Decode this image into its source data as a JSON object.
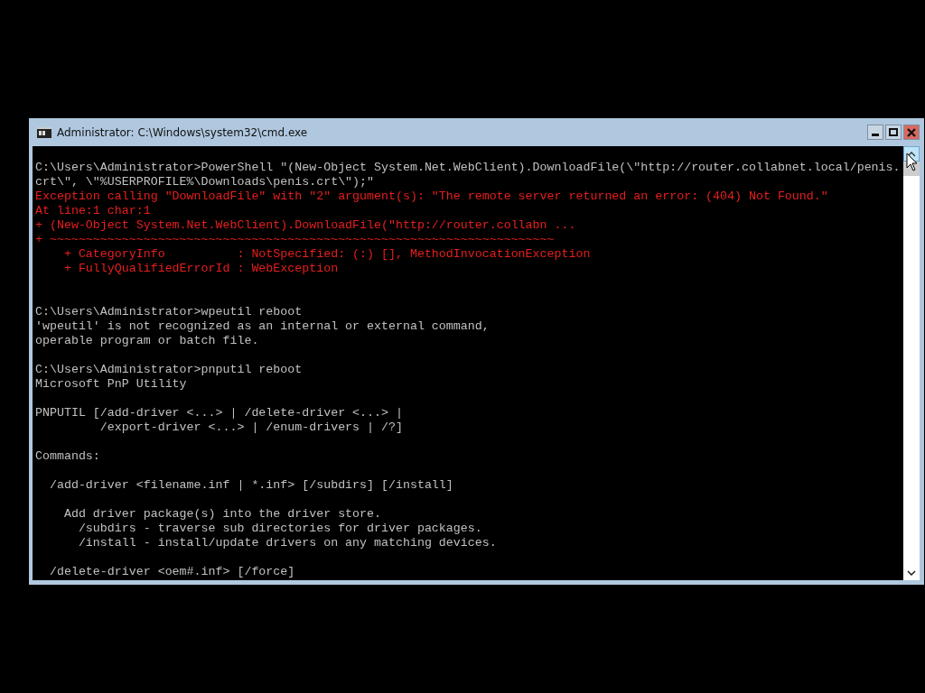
{
  "window": {
    "title": "Administrator: C:\\Windows\\system32\\cmd.exe"
  },
  "console": {
    "lines": [
      {
        "kind": "blank"
      },
      {
        "kind": "output",
        "text": "C:\\Users\\Administrator>PowerShell \"(New-Object System.Net.WebClient).DownloadFile(\\\"http://router.collabnet.local/penis."
      },
      {
        "kind": "output",
        "text": "crt\\\", \\\"%USERPROFILE%\\Downloads\\penis.crt\\\");\""
      },
      {
        "kind": "error",
        "text": "Exception calling \"DownloadFile\" with \"2\" argument(s): \"The remote server returned an error: (404) Not Found.\""
      },
      {
        "kind": "error",
        "text": "At line:1 char:1"
      },
      {
        "kind": "error",
        "text": "+ (New-Object System.Net.WebClient).DownloadFile(\"http://router.collabn ..."
      },
      {
        "kind": "error",
        "text": "+ ~~~~~~~~~~~~~~~~~~~~~~~~~~~~~~~~~~~~~~~~~~~~~~~~~~~~~~~~~~~~~~~~~~~~~~"
      },
      {
        "kind": "error",
        "text": "    + CategoryInfo          : NotSpecified: (:) [], MethodInvocationException"
      },
      {
        "kind": "error",
        "text": "    + FullyQualifiedErrorId : WebException"
      },
      {
        "kind": "blank"
      },
      {
        "kind": "blank"
      },
      {
        "kind": "output",
        "text": "C:\\Users\\Administrator>wpeutil reboot"
      },
      {
        "kind": "output",
        "text": "'wpeutil' is not recognized as an internal or external command,"
      },
      {
        "kind": "output",
        "text": "operable program or batch file."
      },
      {
        "kind": "blank"
      },
      {
        "kind": "output",
        "text": "C:\\Users\\Administrator>pnputil reboot"
      },
      {
        "kind": "output",
        "text": "Microsoft PnP Utility"
      },
      {
        "kind": "blank"
      },
      {
        "kind": "output",
        "text": "PNPUTIL [/add-driver <...> | /delete-driver <...> |"
      },
      {
        "kind": "output",
        "text": "         /export-driver <...> | /enum-drivers | /?]"
      },
      {
        "kind": "blank"
      },
      {
        "kind": "output",
        "text": "Commands:"
      },
      {
        "kind": "blank"
      },
      {
        "kind": "output",
        "text": "  /add-driver <filename.inf | *.inf> [/subdirs] [/install]"
      },
      {
        "kind": "blank"
      },
      {
        "kind": "output",
        "text": "    Add driver package(s) into the driver store."
      },
      {
        "kind": "output",
        "text": "      /subdirs - traverse sub directories for driver packages."
      },
      {
        "kind": "output",
        "text": "      /install - install/update drivers on any matching devices."
      },
      {
        "kind": "blank"
      },
      {
        "kind": "output",
        "text": "  /delete-driver <oem#.inf> [/force]"
      }
    ]
  }
}
